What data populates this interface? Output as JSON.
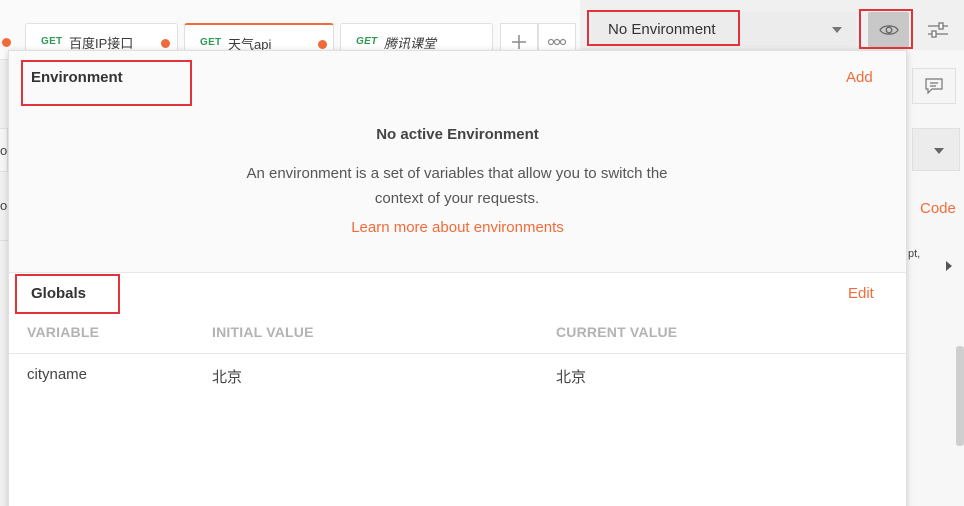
{
  "tabs": [
    {
      "method": "GET",
      "title": "百度IP接口",
      "modified": true,
      "active": false
    },
    {
      "method": "GET",
      "title": "天气api",
      "modified": true,
      "active": true
    },
    {
      "method": "GET",
      "title": "腾讯课堂",
      "modified": false,
      "active": false
    }
  ],
  "tab_actions": {
    "new_tab": "+",
    "more": "ooo"
  },
  "environment_selector": {
    "selected": "No Environment"
  },
  "icons": {
    "eye": "eye-icon",
    "settings": "sliders-icon",
    "dropdown": "caret-down-icon",
    "comment": "comment-icon"
  },
  "popover": {
    "environment": {
      "title": "Environment",
      "add_label": "Add",
      "empty_title": "No active Environment",
      "empty_description": "An environment is a set of variables that allow you to switch the context of your requests.",
      "learn_more": "Learn more about environments"
    },
    "globals": {
      "title": "Globals",
      "edit_label": "Edit",
      "columns": [
        "VARIABLE",
        "INITIAL VALUE",
        "CURRENT VALUE"
      ],
      "rows": [
        {
          "variable": "cityname",
          "initial_value": "北京",
          "current_value": "北京"
        }
      ]
    }
  },
  "background": {
    "code_link": "Code",
    "partial_text_right": "pt,",
    "partial_text_left_1": "oi",
    "partial_text_left_2": "o"
  },
  "colors": {
    "accent": "#f26b3a",
    "get_method": "#2f9a52",
    "highlight_box": "#e3333a"
  }
}
